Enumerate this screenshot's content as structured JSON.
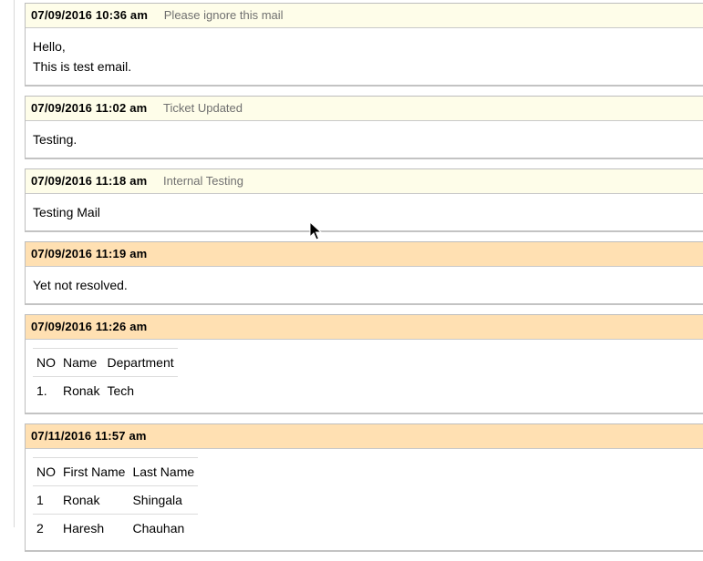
{
  "entries": [
    {
      "type": "message",
      "date": "07/09/2016 10:36 am",
      "title": "Please ignore this mail",
      "lines": [
        "Hello,",
        "This is test email."
      ]
    },
    {
      "type": "message",
      "date": "07/09/2016 11:02 am",
      "title": "Ticket Updated",
      "lines": [
        "Testing."
      ]
    },
    {
      "type": "message",
      "date": "07/09/2016 11:18 am",
      "title": "Internal Testing",
      "lines": [
        "Testing Mail"
      ]
    },
    {
      "type": "response",
      "date": "07/09/2016 11:19 am",
      "title": "",
      "lines": [
        "Yet not resolved."
      ]
    },
    {
      "type": "response",
      "date": "07/09/2016 11:26 am",
      "title": "",
      "table": {
        "headers": [
          "NO",
          "Name",
          "Department"
        ],
        "rows": [
          [
            "1.",
            "Ronak",
            "Tech"
          ]
        ]
      }
    },
    {
      "type": "response",
      "date": "07/11/2016 11:57 am",
      "title": "",
      "table": {
        "headers": [
          "NO",
          "First Name",
          "Last Name"
        ],
        "rows": [
          [
            "1",
            "Ronak",
            "Shingala"
          ],
          [
            "2",
            "Haresh",
            "Chauhan"
          ]
        ]
      }
    }
  ]
}
